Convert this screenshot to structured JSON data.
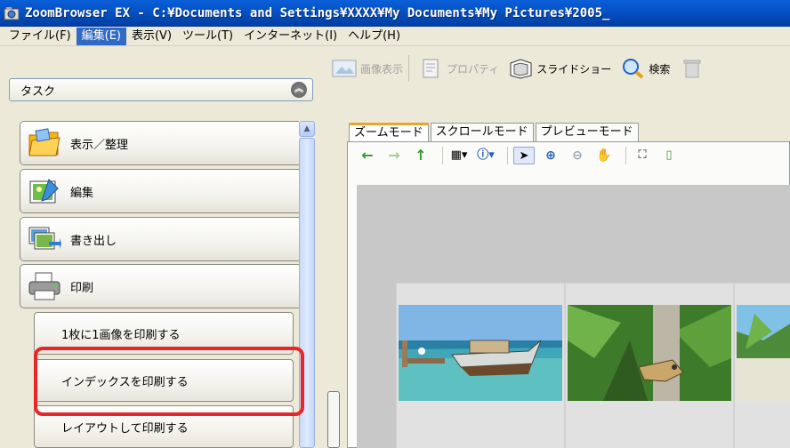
{
  "window": {
    "title": "ZoomBrowser EX - C:¥Documents and Settings¥XXXX¥My Documents¥My Pictures¥2005_"
  },
  "menu": [
    {
      "label": "ファイル(F)",
      "active": false
    },
    {
      "label": "編集(E)",
      "active": true
    },
    {
      "label": "表示(V)",
      "active": false
    },
    {
      "label": "ツール(T)",
      "active": false
    },
    {
      "label": "インターネット(I)",
      "active": false
    },
    {
      "label": "ヘルプ(H)",
      "active": false
    }
  ],
  "task_selector": {
    "value": "タスク",
    "icon": "chevron-up-double-icon"
  },
  "categories": [
    {
      "label": "表示／整理",
      "icon": "folder-icon"
    },
    {
      "label": "編集",
      "icon": "edit-picture-icon"
    },
    {
      "label": "書き出し",
      "icon": "export-pictures-icon"
    },
    {
      "label": "印刷",
      "icon": "printer-icon"
    }
  ],
  "print_options": [
    {
      "label": "1枚に1画像を印刷する"
    },
    {
      "label": "インデックスを印刷する",
      "highlighted": true
    },
    {
      "label": "レイアウトして印刷する"
    }
  ],
  "toolbar": {
    "view_image": "画像表示",
    "properties": "プロパティ",
    "slideshow": "スライドショー",
    "search": "検索"
  },
  "tabs": [
    {
      "label": "ズームモード",
      "active": true
    },
    {
      "label": "スクロールモード",
      "active": false
    },
    {
      "label": "プレビューモード",
      "active": false
    }
  ],
  "colors": {
    "title_bar": "#0553c4",
    "menu_highlight": "#316ac5",
    "annotation_red": "#e8262a",
    "tab_accent": "#f0a32b"
  }
}
